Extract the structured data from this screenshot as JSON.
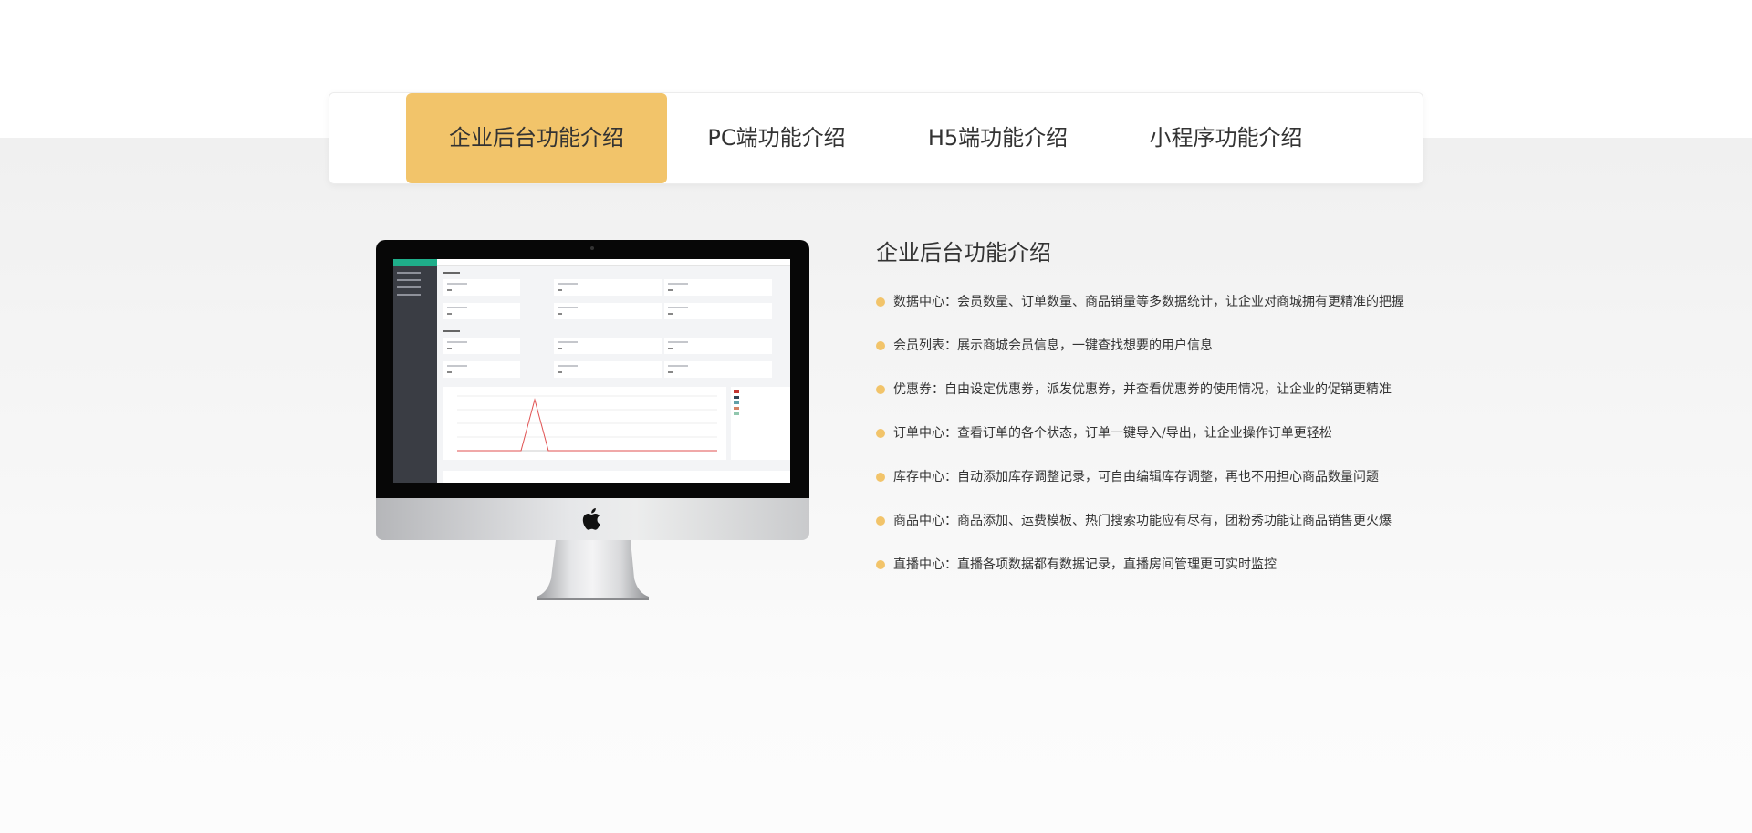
{
  "tabs": [
    {
      "label": "企业后台功能介绍",
      "active": true
    },
    {
      "label": "PC端功能介绍",
      "active": false
    },
    {
      "label": "H5端功能介绍",
      "active": false
    },
    {
      "label": "小程序功能介绍",
      "active": false
    }
  ],
  "section": {
    "title": "企业后台功能介绍",
    "features": [
      {
        "label": "数据中心：",
        "text": "会员数量、订单数量、商品销量等多数据统计，让企业对商城拥有更精准的把握"
      },
      {
        "label": "会员列表：",
        "text": "展示商城会员信息，一键查找想要的用户信息"
      },
      {
        "label": "优惠券：",
        "text": "自由设定优惠券，派发优惠券，并查看优惠券的使用情况，让企业的促销更精准"
      },
      {
        "label": "订单中心：",
        "text": "查看订单的各个状态，订单一键导入/导出，让企业操作订单更轻松"
      },
      {
        "label": "库存中心：",
        "text": "自动添加库存调整记录，可自由编辑库存调整，再也不用担心商品数量问题"
      },
      {
        "label": "商品中心：",
        "text": "商品添加、运费模板、热门搜索功能应有尽有，团粉秀功能让商品销售更火爆"
      },
      {
        "label": "直播中心：",
        "text": "直播各项数据都有数据记录，直播房间管理更可实时监控"
      }
    ]
  },
  "colors": {
    "accent": "#f2c46a",
    "text": "#333333",
    "background": "#f3f3f3"
  },
  "icons": {
    "device": "imac-monitor-icon",
    "logo": "apple-logo-icon",
    "bullet": "bullet-dot-icon"
  }
}
